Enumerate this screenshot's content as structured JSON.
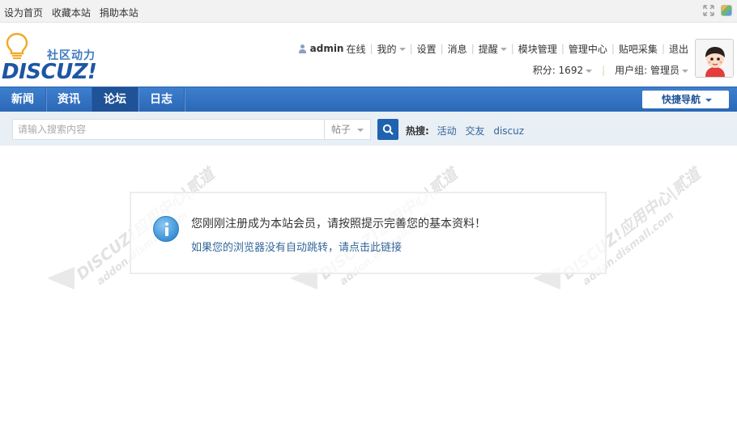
{
  "topbar": {
    "links": [
      "设为首页",
      "收藏本站",
      "捐助本站"
    ]
  },
  "logo": {
    "slogan": "社区动力",
    "wordmark": "DISCUZ!"
  },
  "user_menu": {
    "username": "admin",
    "status": "在线",
    "items": [
      "我的",
      "设置",
      "消息",
      "提醒",
      "模块管理",
      "管理中心",
      "贴吧采集",
      "退出"
    ],
    "points": "积分: 1692",
    "usergroup": "用户组: 管理员"
  },
  "nav": {
    "items": [
      "新闻",
      "资讯",
      "论坛",
      "日志"
    ],
    "active": "论坛",
    "quick_nav": "快捷导航"
  },
  "search": {
    "placeholder": "请输入搜索内容",
    "type": "帖子",
    "hot_label": "热搜:",
    "hot_keywords": [
      "活动",
      "交友",
      "discuz"
    ]
  },
  "message": {
    "main": "您刚刚注册成为本站会员，请按照提示完善您的基本资料！",
    "link": "如果您的浏览器没有自动跳转，请点击此链接"
  },
  "watermark": {
    "line1": "DISCUZ!应用中心|贰道",
    "line2": "addon.dismall.com"
  },
  "colors": {
    "nav_blue": "#2b68b6",
    "link_blue": "#336699",
    "search_bg": "#e8eff5"
  }
}
